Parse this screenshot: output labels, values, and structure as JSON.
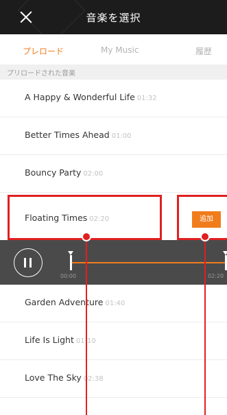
{
  "header": {
    "title": "音楽を選択"
  },
  "tabs": [
    {
      "label": "プレロード",
      "active": true
    },
    {
      "label": "My Music",
      "active": false
    },
    {
      "label": "履歴",
      "active": false
    }
  ],
  "section": {
    "label": "プリロードされた音楽"
  },
  "tracks": [
    {
      "name": "A Happy & Wonderful Life",
      "duration": "01:32"
    },
    {
      "name": "Better Times Ahead",
      "duration": "01:00"
    },
    {
      "name": "Bouncy Party",
      "duration": "02:00"
    },
    {
      "name": "Floating Times",
      "duration": "02:20"
    },
    {
      "name": "Garden Adventure",
      "duration": "01:40"
    },
    {
      "name": "Life Is Light",
      "duration": "01:10"
    },
    {
      "name": "Love The Sky",
      "duration": "02:38"
    }
  ],
  "add_button": {
    "label": "追加"
  },
  "player": {
    "start_time": "00:00",
    "end_time": "02:20"
  },
  "colors": {
    "accent": "#f07c1c",
    "annotation": "#e02020",
    "header_bg": "#1c1c1c",
    "player_bg": "#4a4a4a"
  },
  "icons": {
    "close": "close-icon",
    "pause": "pause-icon"
  }
}
